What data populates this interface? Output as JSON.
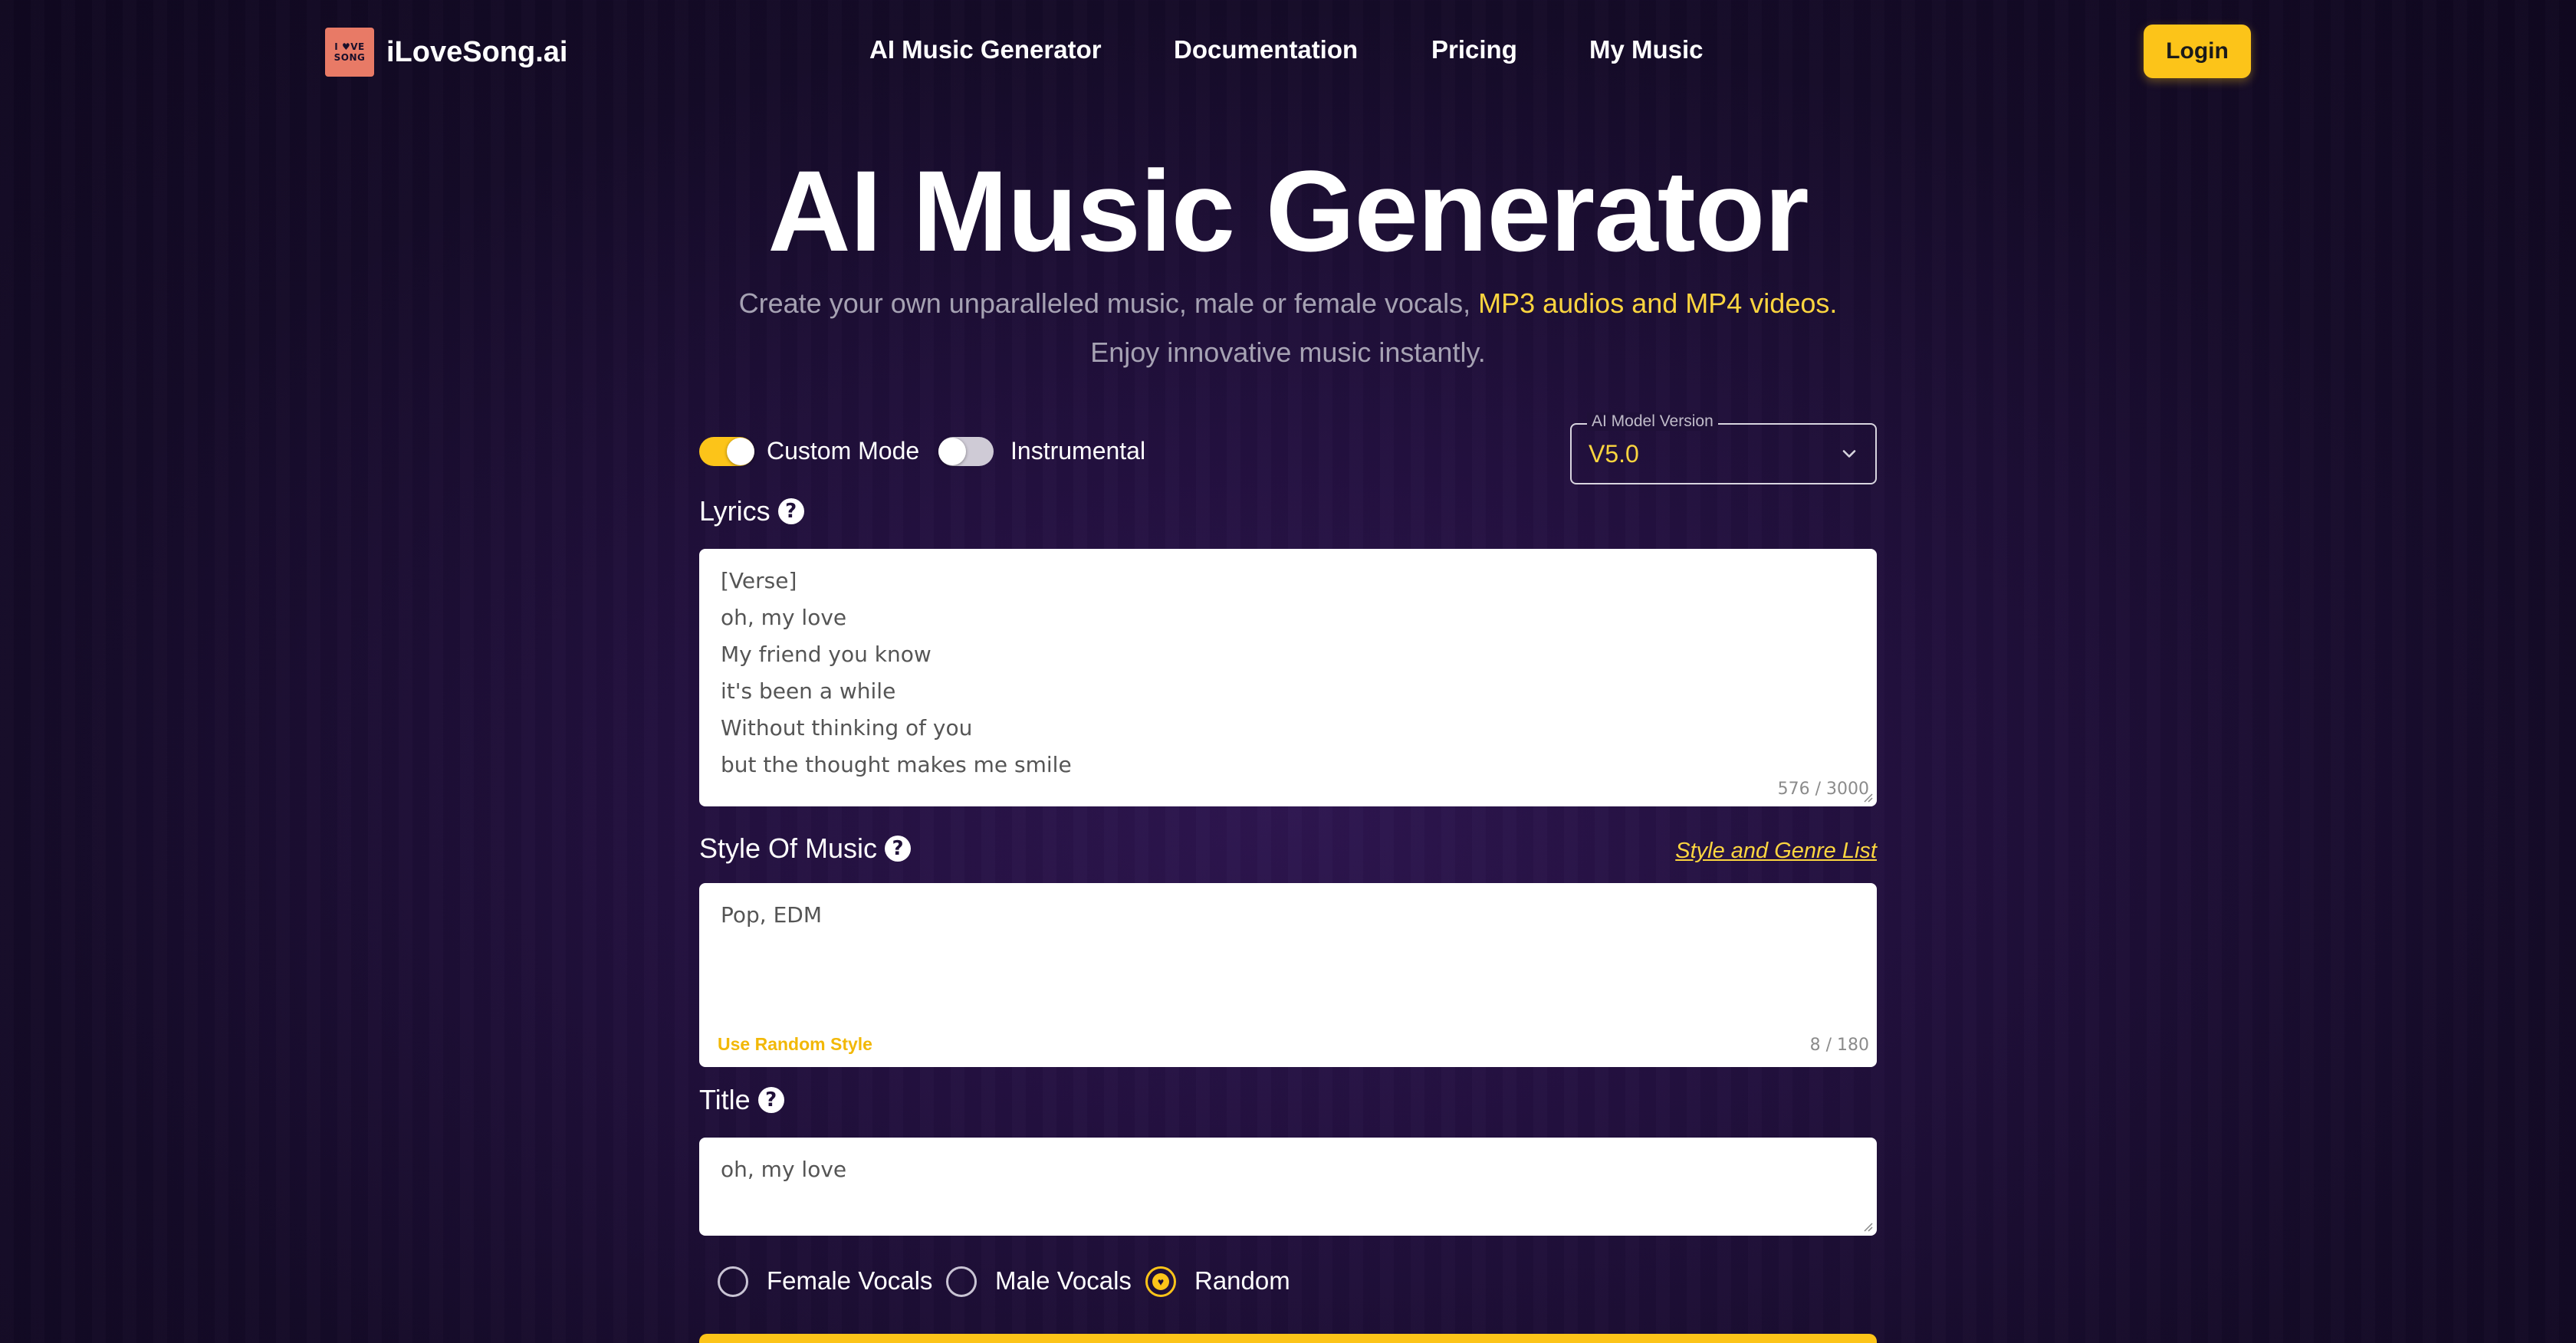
{
  "header": {
    "logo_line1": "I ♥VE",
    "logo_line2": "SONG",
    "logo_text": "iLoveSong.ai",
    "nav": [
      "AI Music Generator",
      "Documentation",
      "Pricing",
      "My Music"
    ],
    "login_label": "Login"
  },
  "hero": {
    "title": "AI Music Generator",
    "subtitle_plain": "Create your own unparalleled music, male or female vocals, ",
    "subtitle_highlight": "MP3 audios and MP4 videos.",
    "subtitle_line2": "Enjoy innovative music instantly."
  },
  "controls": {
    "custom_mode_label": "Custom Mode",
    "custom_mode_on": true,
    "instrumental_label": "Instrumental",
    "instrumental_on": false,
    "model_legend": "AI Model Version",
    "model_value": "V5.0"
  },
  "lyrics": {
    "label": "Lyrics",
    "value": "[Verse]\noh, my love\nMy friend you know\nit's been a while\nWithout thinking of you\nbut the thought makes me smile",
    "counter": "576 / 3000"
  },
  "style": {
    "label": "Style Of Music",
    "link": "Style and Genre List",
    "value": "Pop, EDM",
    "random_label": "Use Random Style",
    "counter": "8 / 180"
  },
  "title_field": {
    "label": "Title",
    "value": "oh, my love"
  },
  "vocals": {
    "options": [
      "Female Vocals",
      "Male Vocals",
      "Random"
    ],
    "selected": "Random"
  },
  "colors": {
    "accent": "#fcc419",
    "highlight_text": "#fcd53f",
    "background": "#1f1038"
  }
}
